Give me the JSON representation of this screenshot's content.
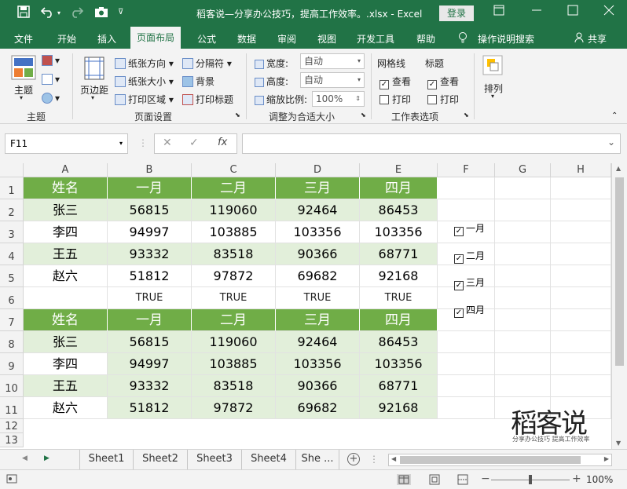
{
  "titlebar": {
    "title": "稻客说—分享办公技巧，提高工作效率。.xlsx  -  Excel",
    "login": "登录",
    "icons": [
      "save-icon",
      "undo-icon",
      "redo-icon",
      "camera-icon",
      "customize-icon"
    ]
  },
  "menu": {
    "items": [
      "文件",
      "开始",
      "插入",
      "页面布局",
      "公式",
      "数据",
      "审阅",
      "视图",
      "开发工具",
      "帮助"
    ],
    "tellme": "操作说明搜索",
    "share": "共享"
  },
  "ribbon": {
    "theme_group": {
      "label": "主题",
      "theme_btn": "主题"
    },
    "page_setup": {
      "label": "页面设置",
      "margins": "页边距",
      "orientation": "纸张方向",
      "size": "纸张大小",
      "print_area": "打印区域",
      "breaks": "分隔符",
      "background": "背景",
      "print_titles": "打印标题"
    },
    "scale": {
      "label": "调整为合适大小",
      "width_label": "宽度:",
      "width_value": "自动",
      "height_label": "高度:",
      "height_value": "自动",
      "scale_label": "缩放比例:",
      "scale_value": "100%"
    },
    "sheet_options": {
      "label": "工作表选项",
      "gridlines": "网格线",
      "headings": "标题",
      "view": "查看",
      "print": "打印"
    },
    "arrange": {
      "label": "排列"
    }
  },
  "formula": {
    "namebox": "F11",
    "fx": "fx",
    "value": ""
  },
  "grid": {
    "columns": [
      "A",
      "B",
      "C",
      "D",
      "E",
      "F",
      "G",
      "H"
    ],
    "rows": [
      "1",
      "2",
      "3",
      "4",
      "5",
      "6",
      "7",
      "8",
      "9",
      "10",
      "11",
      "12",
      "13"
    ],
    "table1": {
      "header": [
        "姓名",
        "一月",
        "二月",
        "三月",
        "四月"
      ],
      "rows": [
        [
          "张三",
          "56815",
          "119060",
          "92464",
          "86453"
        ],
        [
          "李四",
          "94997",
          "103885",
          "103356",
          "103356"
        ],
        [
          "王五",
          "93332",
          "83518",
          "90366",
          "68771"
        ],
        [
          "赵六",
          "51812",
          "97872",
          "69682",
          "92168"
        ]
      ]
    },
    "row6": [
      "TRUE",
      "TRUE",
      "TRUE",
      "TRUE"
    ],
    "table2": {
      "header": [
        "姓名",
        "一月",
        "二月",
        "三月",
        "四月"
      ],
      "rows": [
        [
          "张三",
          "56815",
          "119060",
          "92464",
          "86453"
        ],
        [
          "李四",
          "94997",
          "103885",
          "103356",
          "103356"
        ],
        [
          "王五",
          "93332",
          "83518",
          "90366",
          "68771"
        ],
        [
          "赵六",
          "51812",
          "97872",
          "69682",
          "92168"
        ]
      ]
    },
    "checkboxes": [
      "一月",
      "二月",
      "三月",
      "四月"
    ],
    "logo_text": "稻客说",
    "logo_tagline": "分享办公技巧 提高工作效率"
  },
  "sheets": [
    "Sheet1",
    "Sheet2",
    "Sheet3",
    "Sheet4",
    "She ..."
  ],
  "status": {
    "zoom": "100%"
  },
  "colors": {
    "brand": "#217346",
    "header_green": "#70ad47",
    "band_green": "#e2efda"
  }
}
